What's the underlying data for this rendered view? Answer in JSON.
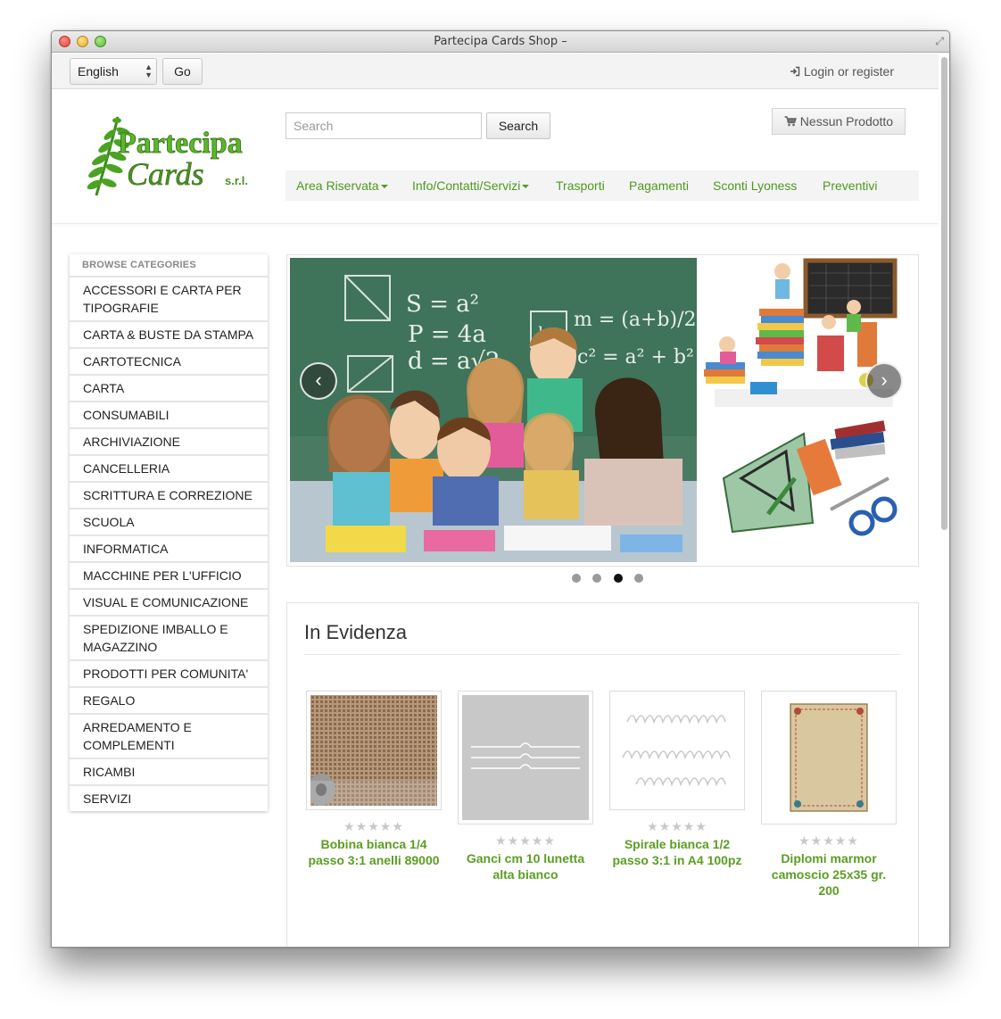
{
  "window": {
    "title": "Partecipa Cards Shop –"
  },
  "topbar": {
    "language_value": "English",
    "go_label": "Go",
    "login_label": "Login or register"
  },
  "header": {
    "logo_text_line1": "Partecipa",
    "logo_text_line2": "Cards",
    "logo_suffix": "s.r.l.",
    "search_placeholder": "Search",
    "search_button": "Search",
    "cart_label": "Nessun Prodotto"
  },
  "nav": {
    "items": [
      {
        "label": "Area Riservata",
        "dropdown": true
      },
      {
        "label": "Info/Contatti/Servizi",
        "dropdown": true
      },
      {
        "label": "Trasporti",
        "dropdown": false
      },
      {
        "label": "Pagamenti",
        "dropdown": false
      },
      {
        "label": "Sconti Lyoness",
        "dropdown": false
      },
      {
        "label": "Preventivi",
        "dropdown": false
      }
    ]
  },
  "sidebar": {
    "title": "BROWSE CATEGORIES",
    "items": [
      "ACCESSORI E CARTA PER TIPOGRAFIE",
      "CARTA & BUSTE DA STAMPA",
      "CARTOTECNICA",
      "CARTA",
      "CONSUMABILI",
      "ARCHIVIAZIONE",
      "CANCELLERIA",
      "SCRITTURA E CORREZIONE",
      "SCUOLA",
      "INFORMATICA",
      "MACCHINE PER L'UFFICIO",
      "VISUAL E COMUNICAZIONE",
      "SPEDIZIONE IMBALLO E MAGAZZINO",
      "PRODOTTI PER COMUNITA'",
      "REGALO",
      "ARREDAMENTO E COMPLEMENTI",
      "RICAMBI",
      "SERVIZI"
    ]
  },
  "slider": {
    "prev_icon": "chevron-left-icon",
    "next_icon": "chevron-right-icon",
    "prev_glyph": "‹",
    "next_glyph": "›",
    "dots": 4,
    "active_dot": 3,
    "board_text": [
      "S = a²",
      "P = 4a",
      "d = a√2",
      "m = (a+b)/2",
      "h",
      "c² = a² + b²"
    ]
  },
  "featured": {
    "title": "In Evidenza",
    "products": [
      {
        "name": "Bobina bianca 1/4 passo 3:1 anelli 89000",
        "rating": 0
      },
      {
        "name": "Ganci cm 10 lunetta alta bianco",
        "rating": 0
      },
      {
        "name": "Spirale bianca 1/2 passo 3:1 in A4 100pz",
        "rating": 0
      },
      {
        "name": "Diplomi marmor camoscio 25x35 gr. 200",
        "rating": 0
      }
    ]
  },
  "colors": {
    "brand_green": "#4c9a1d",
    "product_green": "#5a9e22"
  }
}
